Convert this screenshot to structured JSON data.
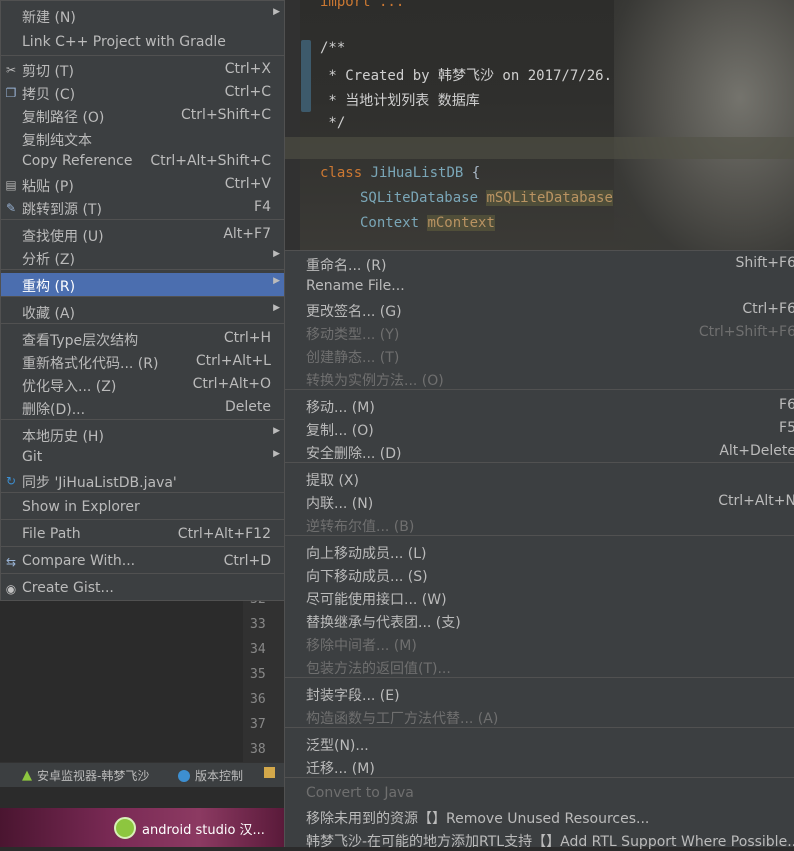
{
  "editor": {
    "line0": "import ...",
    "comment": [
      "/**",
      " * Created by 韩梦飞沙 on 2017/7/26.",
      " * 当地计划列表 数据库",
      " */"
    ],
    "class_kw": "class",
    "class_name": "JiHuaListDB",
    "brace": "{",
    "field1_type": "SQLiteDatabase",
    "field1_name": "mSQLiteDatabase",
    "field2_type": "Context",
    "field2_name": "mContext"
  },
  "line_numbers": [
    "32",
    "33",
    "34",
    "35",
    "36",
    "37",
    "38"
  ],
  "statusbar": {
    "android_monitor": "安卓监视器-韩梦飞沙",
    "version_control": "版本控制"
  },
  "taskbar": {
    "app": "android studio 汉..."
  },
  "main_menu": [
    {
      "label": "新建 (N)",
      "shortcut": "",
      "submenu": true
    },
    {
      "label": "Link C++ Project with Gradle",
      "shortcut": ""
    },
    {
      "label": "剪切 (T)",
      "shortcut": "Ctrl+X",
      "icon": "scissors-icon"
    },
    {
      "label": "拷贝 (C)",
      "shortcut": "Ctrl+C",
      "icon": "copy-icon"
    },
    {
      "label": "复制路径 (O)",
      "shortcut": "Ctrl+Shift+C"
    },
    {
      "label": "复制纯文本",
      "shortcut": ""
    },
    {
      "label": "Copy Reference",
      "shortcut": "Ctrl+Alt+Shift+C"
    },
    {
      "label": "粘贴 (P)",
      "shortcut": "Ctrl+V",
      "icon": "paste-icon"
    },
    {
      "label": "跳转到源 (T)",
      "shortcut": "F4",
      "icon": "jump-to-source-icon"
    },
    {
      "label": "查找使用 (U)",
      "shortcut": "Alt+F7"
    },
    {
      "label": "分析 (Z)",
      "shortcut": "",
      "submenu": true
    },
    {
      "label": "重构 (R)",
      "shortcut": "",
      "submenu": true,
      "selected": true
    },
    {
      "label": "收藏 (A)",
      "shortcut": "",
      "submenu": true
    },
    {
      "label": "查看Type层次结构",
      "shortcut": "Ctrl+H"
    },
    {
      "label": "重新格式化代码... (R)",
      "shortcut": "Ctrl+Alt+L"
    },
    {
      "label": "优化导入... (Z)",
      "shortcut": "Ctrl+Alt+O"
    },
    {
      "label": "删除(D)...",
      "shortcut": "Delete"
    },
    {
      "label": "本地历史 (H)",
      "shortcut": "",
      "submenu": true
    },
    {
      "label": "Git",
      "shortcut": "",
      "submenu": true
    },
    {
      "label": "同步 'JiHuaListDB.java'",
      "shortcut": "",
      "icon": "sync-icon"
    },
    {
      "label": "Show in Explorer",
      "shortcut": ""
    },
    {
      "label": "File Path",
      "shortcut": "Ctrl+Alt+F12"
    },
    {
      "label": "Compare With...",
      "shortcut": "Ctrl+D",
      "icon": "compare-icon"
    },
    {
      "label": "Create Gist...",
      "shortcut": "",
      "icon": "github-icon"
    }
  ],
  "sub_menu": [
    {
      "label": "重命名... (R)",
      "shortcut": "Shift+F6"
    },
    {
      "label": "Rename File...",
      "shortcut": ""
    },
    {
      "label": "更改签名... (G)",
      "shortcut": "Ctrl+F6"
    },
    {
      "label": "移动类型... (Y)",
      "shortcut": "Ctrl+Shift+F6",
      "disabled": true
    },
    {
      "label": "创建静态... (T)",
      "shortcut": "",
      "disabled": true
    },
    {
      "label": "转换为实例方法... (O)",
      "shortcut": "",
      "disabled": true
    },
    {
      "label": "移动... (M)",
      "shortcut": "F6"
    },
    {
      "label": "复制... (O)",
      "shortcut": "F5"
    },
    {
      "label": "安全删除... (D)",
      "shortcut": "Alt+Delete"
    },
    {
      "label": "提取 (X)",
      "shortcut": "",
      "submenu": true
    },
    {
      "label": "内联... (N)",
      "shortcut": "Ctrl+Alt+N"
    },
    {
      "label": "逆转布尔值... (B)",
      "shortcut": "",
      "disabled": true
    },
    {
      "label": "向上移动成员... (L)",
      "shortcut": ""
    },
    {
      "label": "向下移动成员... (S)",
      "shortcut": ""
    },
    {
      "label": "尽可能使用接口... (W)",
      "shortcut": ""
    },
    {
      "label": "替换继承与代表团... (支)",
      "shortcut": ""
    },
    {
      "label": "移除中间者... (M)",
      "shortcut": "",
      "disabled": true
    },
    {
      "label": "包装方法的返回值(T)...",
      "shortcut": "",
      "disabled": true
    },
    {
      "label": "封装字段... (E)",
      "shortcut": ""
    },
    {
      "label": "构造函数与工厂方法代替... (A)",
      "shortcut": "",
      "disabled": true
    },
    {
      "label": "泛型(N)...",
      "shortcut": ""
    },
    {
      "label": "迁移... (M)",
      "shortcut": ""
    },
    {
      "label": "Convert to Java",
      "shortcut": "",
      "disabled": true
    },
    {
      "label": "移除未用到的资源【】Remove Unused Resources...",
      "shortcut": ""
    },
    {
      "label": "韩梦飞沙-在可能的地方添加RTL支持【】Add RTL Support Where Possible...",
      "shortcut": ""
    }
  ],
  "colors": {
    "menu_bg": "#3c3f41",
    "selected": "#4b6eaf",
    "disabled": "#6f6f6f",
    "text": "#bbbbbb"
  }
}
